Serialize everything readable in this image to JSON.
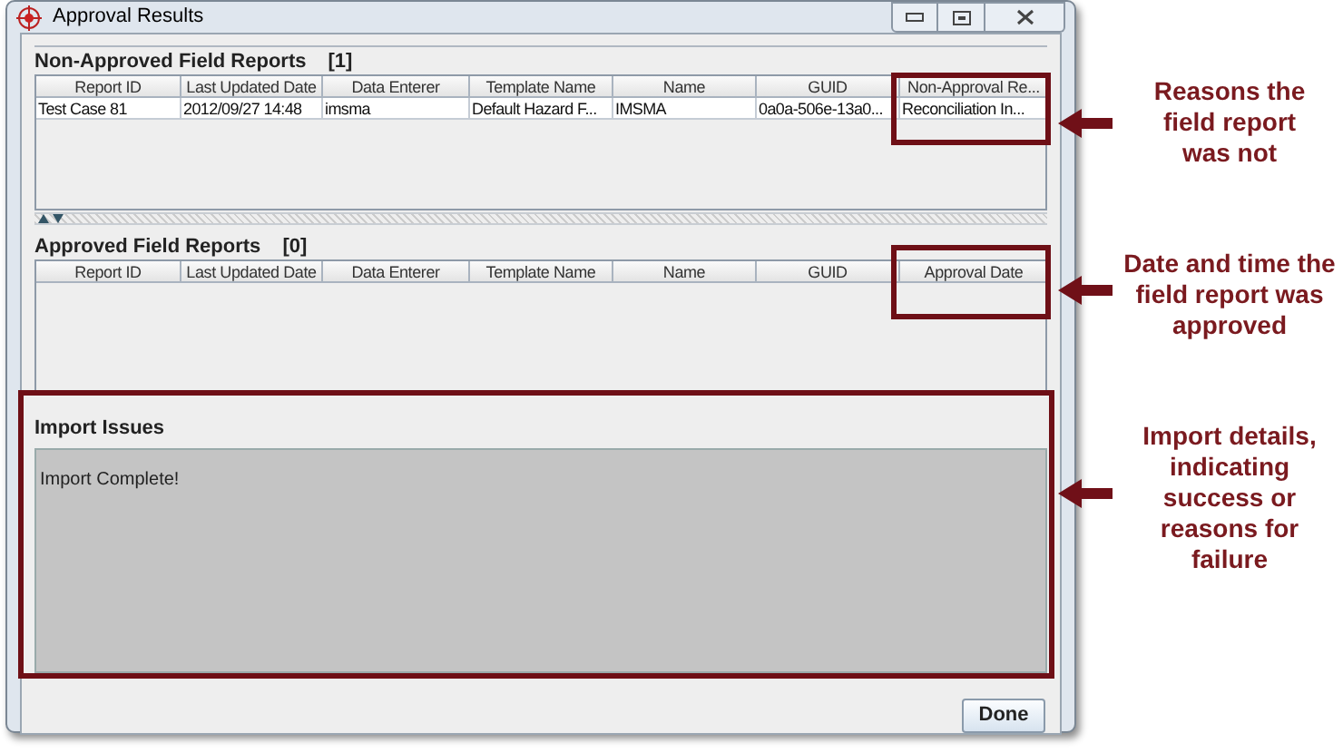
{
  "window": {
    "title": "Approval Results"
  },
  "tables": [
    {
      "title": "Non-Approved Field Reports",
      "count": "[1]",
      "columns": [
        "Report ID",
        "Last Updated Date",
        "Data Enterer",
        "Template Name",
        "Name",
        "GUID",
        "Non-Approval Re..."
      ],
      "rows": [
        [
          "Test Case 81",
          "2012/09/27 14:48",
          "imsma",
          "Default Hazard F...",
          "IMSMA",
          "0a0a-506e-13a0...",
          "Reconciliation In..."
        ]
      ]
    },
    {
      "title": "Approved Field Reports",
      "count": "[0]",
      "columns": [
        "Report ID",
        "Last Updated Date",
        "Data Enterer",
        "Template Name",
        "Name",
        "GUID",
        "Approval Date"
      ]
    }
  ],
  "import_issues": {
    "title": "Import Issues",
    "text": "Import Complete!"
  },
  "buttons": [
    "Done"
  ],
  "callouts": [
    {
      "text": "Reasons the field report was not"
    },
    {
      "text": "Date and time the field report was approved"
    },
    {
      "text": "Import details, indicating success or reasons for failure"
    }
  ]
}
